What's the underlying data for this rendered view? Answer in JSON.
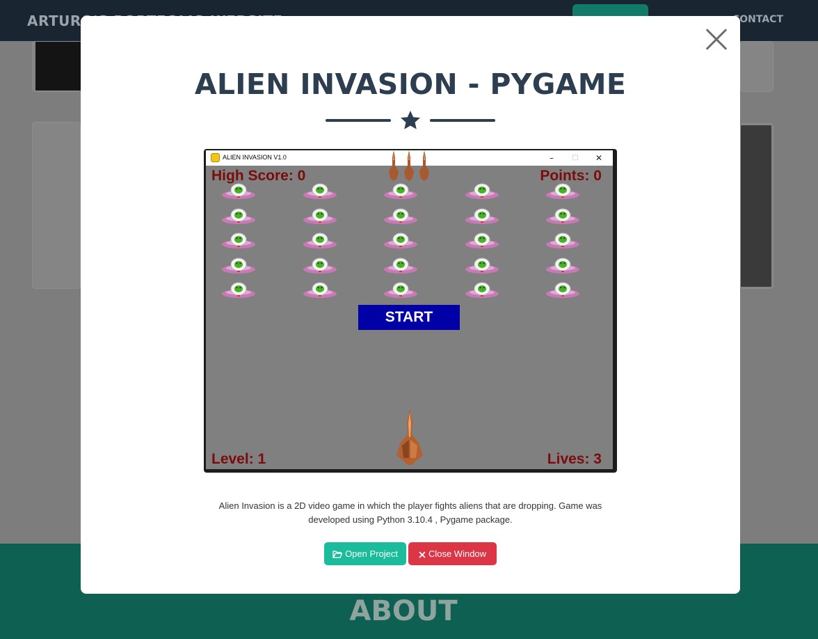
{
  "navbar": {
    "brand": "ARTURO'S PORTFOLIO WEBSITE",
    "contact": "CONTACT"
  },
  "about": {
    "title": "ABOUT"
  },
  "modal": {
    "title": "ALIEN INVASION - PYGAME",
    "description": "Alien Invasion is a 2D video game in which the player fights aliens that are dropping. Game was developed using Python 3.10.4 , Pygame package.",
    "buttons": {
      "open": "Open Project",
      "close": "Close Window"
    },
    "colors": {
      "title": "#2c3e50",
      "open_button": "#1abc9c",
      "close_button": "#dc3545"
    }
  },
  "game": {
    "window_title": "ALIEN INVASION V1.0",
    "high_score": "High Score: 0",
    "points": "Points: 0",
    "level": "Level: 1",
    "lives": "Lives: 3",
    "start_label": "START",
    "alien_rows": 5,
    "alien_cols": 5,
    "remaining_ships": 3
  }
}
